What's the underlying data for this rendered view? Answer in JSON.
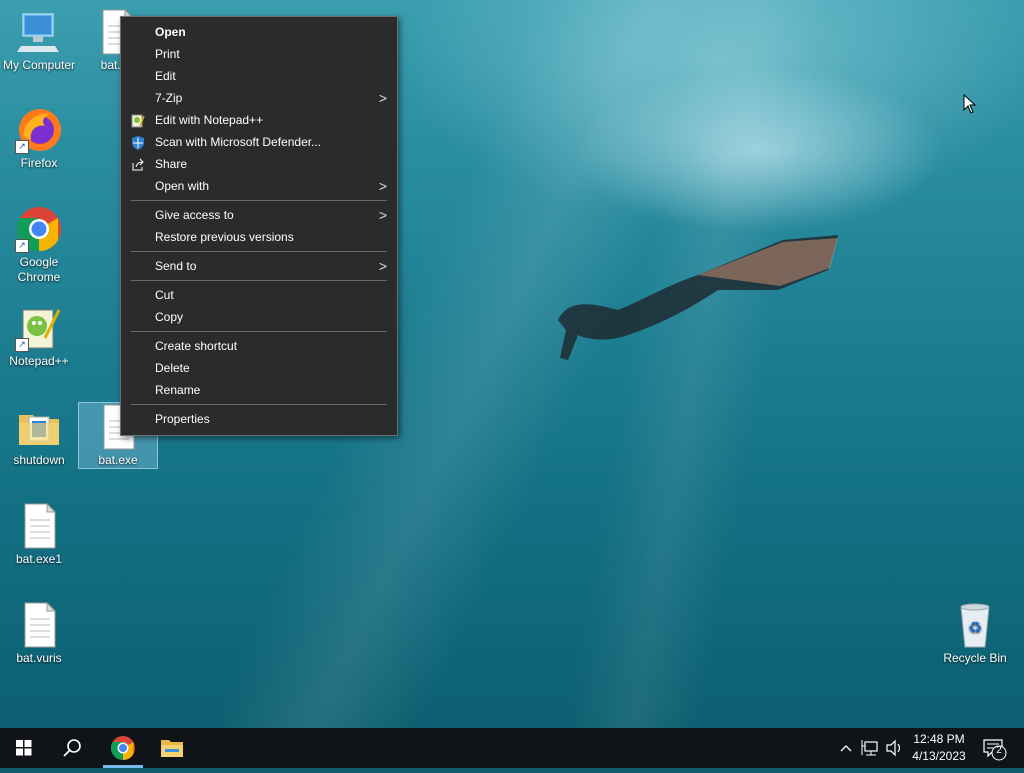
{
  "desktop": {
    "icons": [
      {
        "label": "My Computer"
      },
      {
        "label": "bat.vu"
      },
      {
        "label": "Firefox"
      },
      {
        "label": "Google Chrome"
      },
      {
        "label": "Notepad++"
      },
      {
        "label": "shutdown"
      },
      {
        "label": "bat.exe"
      },
      {
        "label": "bat.exe1"
      },
      {
        "label": "bat.vuris"
      },
      {
        "label": "Recycle Bin"
      }
    ]
  },
  "context_menu": {
    "items": [
      {
        "label": "Open"
      },
      {
        "label": "Print"
      },
      {
        "label": "Edit"
      },
      {
        "label": "7-Zip"
      },
      {
        "label": "Edit with Notepad++"
      },
      {
        "label": "Scan with Microsoft Defender..."
      },
      {
        "label": "Share"
      },
      {
        "label": "Open with"
      },
      {
        "label": "Give access to"
      },
      {
        "label": "Restore previous versions"
      },
      {
        "label": "Send to"
      },
      {
        "label": "Cut"
      },
      {
        "label": "Copy"
      },
      {
        "label": "Create shortcut"
      },
      {
        "label": "Delete"
      },
      {
        "label": "Rename"
      },
      {
        "label": "Properties"
      }
    ],
    "submenu_arrow": ">"
  },
  "taskbar": {
    "clock_time": "12:48 PM",
    "clock_date": "4/13/2023",
    "notification_count": "2",
    "pinned": [
      "windows-start",
      "search",
      "google-chrome",
      "file-explorer"
    ]
  },
  "colors": {
    "menu_bg": "#2b2b2b",
    "taskbar_bg": "#101418",
    "accent": "#76b9ed"
  }
}
